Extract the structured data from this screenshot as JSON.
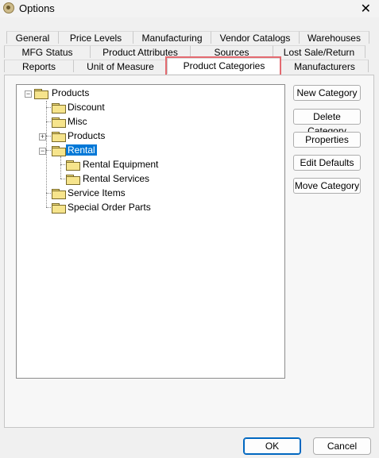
{
  "window": {
    "title": "Options",
    "close_glyph": "✕"
  },
  "tabs": {
    "row1": [
      "General",
      "Price Levels",
      "Manufacturing",
      "Vendor Catalogs",
      "Warehouses"
    ],
    "row2": [
      "MFG Status",
      "Product Attributes",
      "Sources",
      "Lost Sale/Return"
    ],
    "row3": [
      "Reports",
      "Unit of Measure",
      "Product Categories",
      "Manufacturers"
    ],
    "active": "Product Categories"
  },
  "tree": {
    "nodes": [
      {
        "label": "Products",
        "expander": "−"
      },
      {
        "label": "Discount"
      },
      {
        "label": "Misc"
      },
      {
        "label": "Products",
        "expander": "+"
      },
      {
        "label": "Rental",
        "expander": "−",
        "selected": true
      },
      {
        "label": "Rental Equipment"
      },
      {
        "label": "Rental Services"
      },
      {
        "label": "Service Items"
      },
      {
        "label": "Special Order Parts"
      }
    ]
  },
  "buttons": {
    "new_category": "New Category",
    "delete_category": "Delete Category",
    "properties": "Properties",
    "edit_defaults": "Edit Defaults",
    "move_category": "Move Category"
  },
  "footer": {
    "ok": "OK",
    "cancel": "Cancel"
  },
  "colors": {
    "selection": "#0078d7",
    "highlight_box": "#e36a70",
    "folder": "#f6e48c"
  }
}
